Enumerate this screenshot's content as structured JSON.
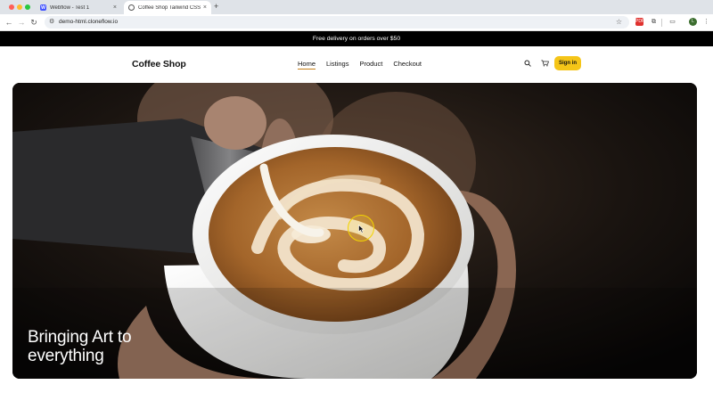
{
  "browser": {
    "tabs": [
      {
        "title": "Webflow - Test 1",
        "favicon": "webflow-icon",
        "favicon_text": "W",
        "active": false
      },
      {
        "title": "Coffee Shop Tailwind CSS Te",
        "favicon": "globe-icon",
        "active": true
      }
    ],
    "new_tab": "+",
    "close_glyph": "×",
    "url": "demo-html.cloneflow.io",
    "avatar_initial": "L",
    "pdf_label": "PDF"
  },
  "banner": {
    "text": "Free delivery on orders over $50"
  },
  "nav": {
    "brand": "Coffee Shop",
    "links": [
      {
        "label": "Home",
        "active": true
      },
      {
        "label": "Listings"
      },
      {
        "label": "Product"
      },
      {
        "label": "Checkout"
      }
    ],
    "search_icon": "search-icon",
    "cart_icon": "cart-icon",
    "signin_label": "Sign in"
  },
  "hero": {
    "title": "Bringing Art to everything"
  },
  "colors": {
    "accent": "#f5c518",
    "banner_bg": "#000000",
    "coffee": "#a86a2e",
    "cup": "#f2f2f0"
  }
}
